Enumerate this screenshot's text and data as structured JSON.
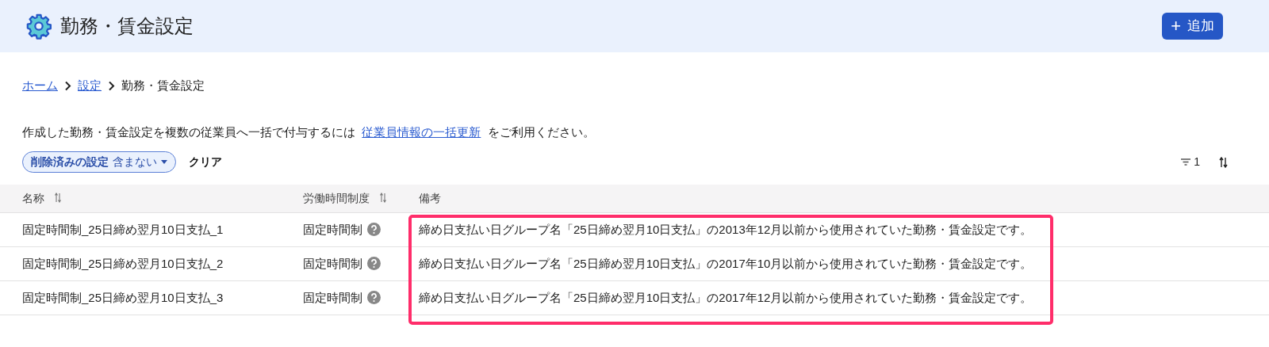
{
  "header": {
    "title": "勤務・賃金設定",
    "add_button": {
      "icon": "+",
      "label": "追加"
    }
  },
  "breadcrumb": [
    {
      "label": "ホーム",
      "link": true
    },
    {
      "label": "設定",
      "link": true
    },
    {
      "label": "勤務・賃金設定",
      "link": false
    }
  ],
  "info": {
    "before": "作成した勤務・賃金設定を複数の従業員へ一括で付与するには",
    "link": "従業員情報の一括更新",
    "after": "をご利用ください。"
  },
  "filter_chip": {
    "label": "削除済みの設定",
    "value": "含まない"
  },
  "clear_button": "クリア",
  "filter_count": "1",
  "table": {
    "highlight_notes": true,
    "columns": [
      {
        "label": "名称",
        "sortable": true
      },
      {
        "label": "労働時間制度",
        "sortable": true
      },
      {
        "label": "備考",
        "sortable": false
      }
    ],
    "rows": [
      {
        "name": "固定時間制_25日締め翌月10日支払_1",
        "system": "固定時間制",
        "help": true,
        "notes": "締め日支払い日グループ名「25日締め翌月10日支払」の2013年12月以前から使用されていた勤務・賃金設定です。"
      },
      {
        "name": "固定時間制_25日締め翌月10日支払_2",
        "system": "固定時間制",
        "help": true,
        "notes": "締め日支払い日グループ名「25日締め翌月10日支払」の2017年10月以前から使用されていた勤務・賃金設定です。"
      },
      {
        "name": "固定時間制_25日締め翌月10日支払_3",
        "system": "固定時間制",
        "help": true,
        "notes": "締め日支払い日グループ名「25日締め翌月10日支払」の2017年12月以前から使用されていた勤務・賃金設定です。"
      }
    ]
  }
}
